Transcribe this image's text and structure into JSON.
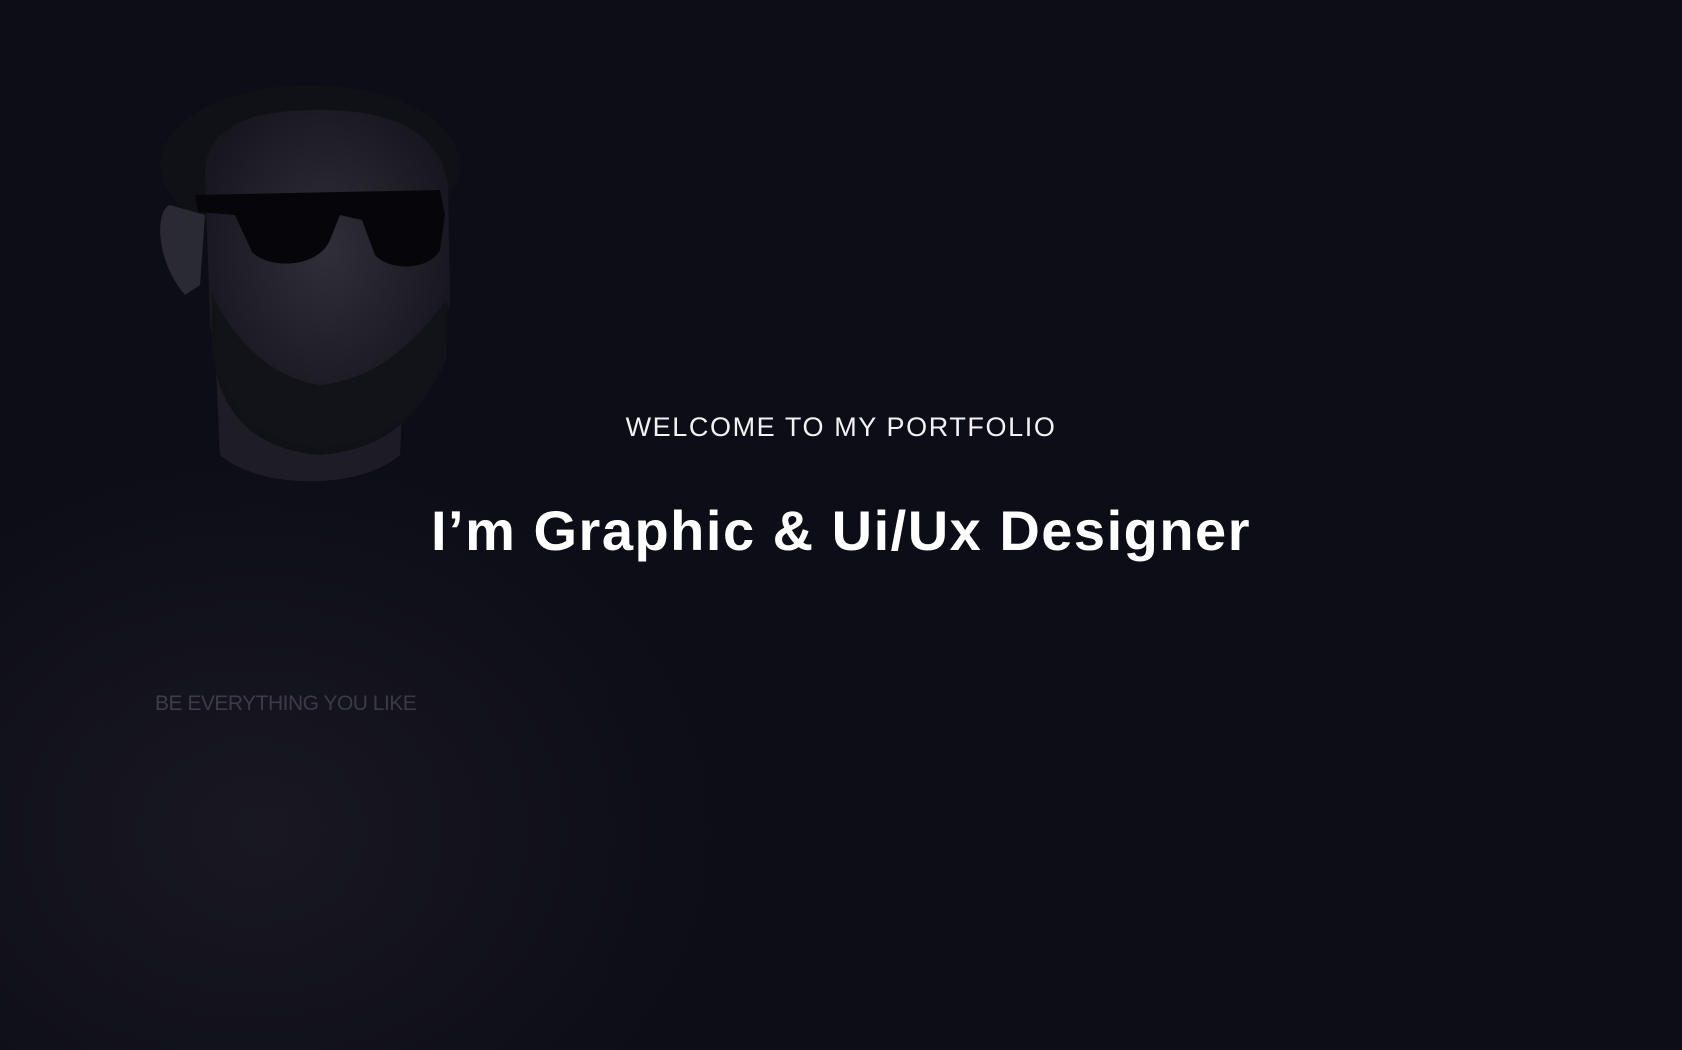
{
  "hero": {
    "subtitle": "WELCOME TO MY PORTFOLIO",
    "title": "I’m Graphic & Ui/Ux Designer",
    "shirt_text": "BE EVERYTHING YOU LIKE"
  },
  "colors": {
    "background": "#0d0d17",
    "text": "#ffffff"
  }
}
